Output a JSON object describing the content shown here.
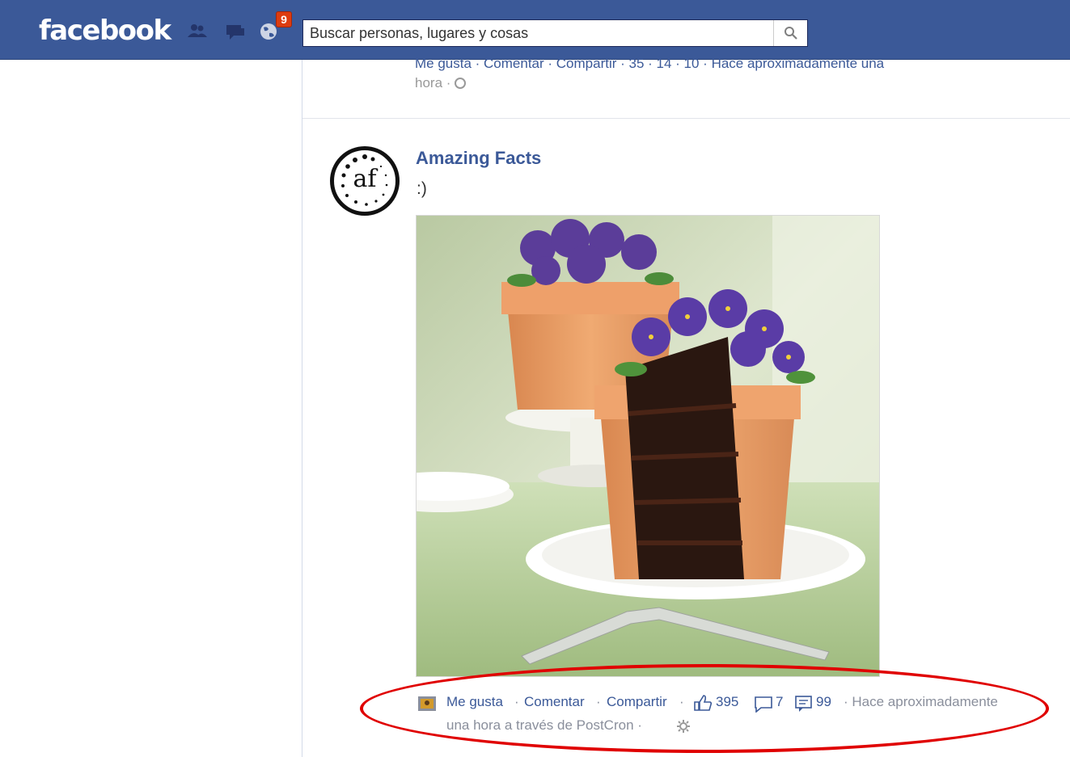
{
  "header": {
    "logo": "facebook",
    "notifications_count": "9",
    "search_placeholder": "Buscar personas, lugares y cosas"
  },
  "previous_post": {
    "actions_line": "Me gusta · Comentar · Compartir · 35 · 14 · 10 · Hace aproximadamente una",
    "time_line2": "hora ·"
  },
  "post": {
    "author": "Amazing Facts",
    "avatar_text": "af",
    "message": ":)",
    "actions": {
      "like": "Me gusta",
      "comment": "Comentar",
      "share": "Compartir",
      "likes_count": "395",
      "comments_count": "7",
      "shares_count": "99",
      "time_line1": "· Hace aproximadamente",
      "time_line2": "una hora a través de PostCron ·"
    }
  },
  "colors": {
    "facebook_blue": "#3b5998",
    "link": "#3b5998",
    "highlight": "#e00000"
  }
}
